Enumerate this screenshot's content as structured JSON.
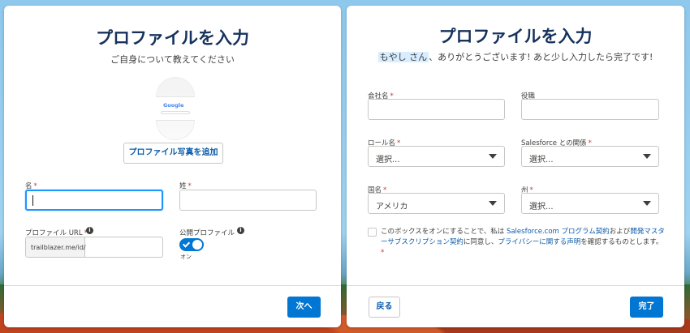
{
  "left": {
    "title": "プロファイルを入力",
    "subtitle": "ご自身について教えてください",
    "avatar_logo": "Google",
    "add_photo_label": "プロファイル写真を追加",
    "first_name_label": "名",
    "last_name_label": "姓",
    "required_mark": "*",
    "profile_url_label": "プロファイル URL",
    "profile_url_prefix": "trailblazer.me/id/",
    "public_profile_label": "公開プロファイル",
    "toggle_state_label": "オン",
    "next_label": "次へ"
  },
  "right": {
    "title": "プロファイルを入力",
    "greeting_name": "もやし さん",
    "greeting_text": "、ありがとうございます! あと少し入力したら完了です!",
    "company_label": "会社名",
    "title_label": "役職",
    "role_label": "ロール名",
    "relation_label": "Salesforce との関係",
    "country_label": "国名",
    "state_label": "州",
    "select_placeholder": "選択...",
    "country_value": "アメリカ",
    "required_mark": "*",
    "consent_part1": "このボックスをオンにすることで、私は ",
    "consent_link1": "Salesforce.com プログラム契約",
    "consent_part2": "および",
    "consent_link2": "開発マスターサブスクリプション契約",
    "consent_part3": "に同意し、",
    "consent_link3": "プライバシーに関する声明",
    "consent_part4": "を確認するものとします。",
    "back_label": "戻る",
    "finish_label": "完了"
  },
  "colors": {
    "brand": "#0176d3",
    "title": "#16325c",
    "required": "#c23934",
    "link": "#0b5cab"
  }
}
